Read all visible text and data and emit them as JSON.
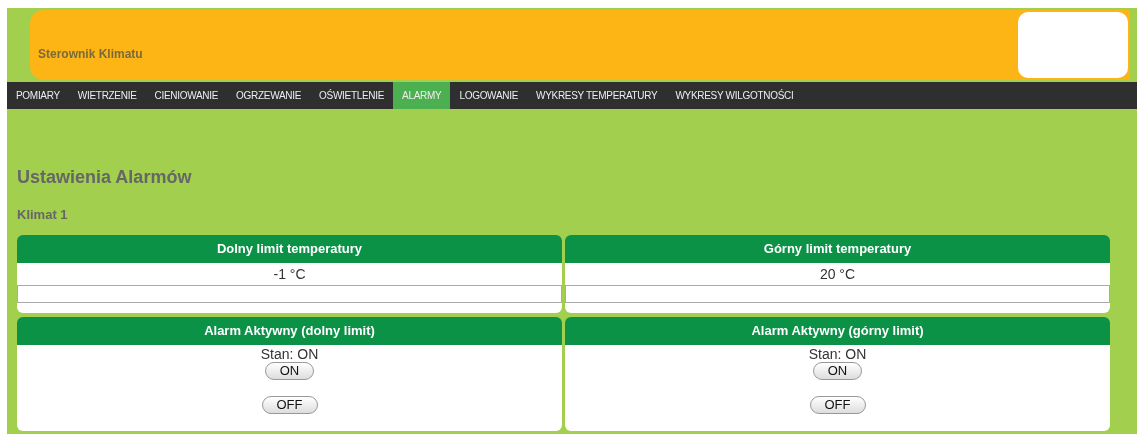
{
  "header": {
    "title": "Sterownik Klimatu"
  },
  "nav": [
    {
      "label": "POMIARY",
      "selected": false
    },
    {
      "label": "WIETRZENIE",
      "selected": false
    },
    {
      "label": "CIENIOWANIE",
      "selected": false
    },
    {
      "label": "OGRZEWANIE",
      "selected": false
    },
    {
      "label": "OŚWIETLENIE",
      "selected": false
    },
    {
      "label": "ALARMY",
      "selected": true
    },
    {
      "label": "LOGOWANIE",
      "selected": false
    },
    {
      "label": "WYKRESY TEMPERATURY",
      "selected": false
    },
    {
      "label": "WYKRESY WILGOTNOŚCI",
      "selected": false
    }
  ],
  "page_title": "Ustawienia Alarmów",
  "section": "Klimat 1",
  "panels": [
    {
      "kind": "limit",
      "title": "Dolny limit temperatury",
      "reading": "-1 °C"
    },
    {
      "kind": "limit",
      "title": "Górny limit temperatury",
      "reading": "20 °C"
    },
    {
      "kind": "toggle",
      "title": "Alarm Aktywny (dolny limit)",
      "status": "Stan: ON",
      "buttons": [
        "ON",
        "OFF"
      ]
    },
    {
      "kind": "toggle",
      "title": "Alarm Aktywny (górny limit)",
      "status": "Stan: ON",
      "buttons": [
        "ON",
        "OFF"
      ]
    }
  ]
}
